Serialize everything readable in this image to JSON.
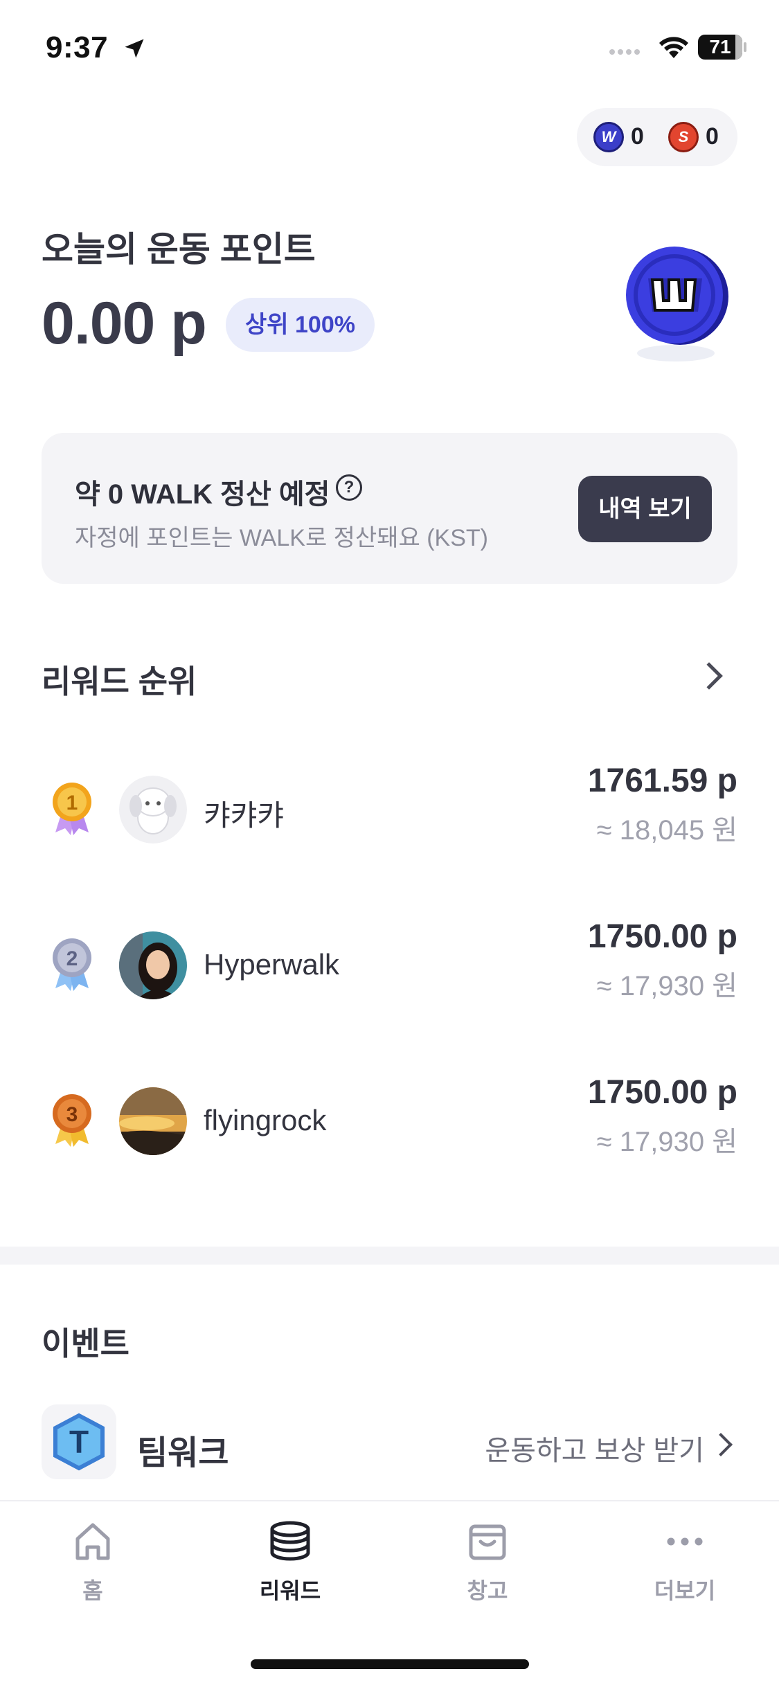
{
  "status_bar": {
    "time": "9:37",
    "battery": "71",
    "icons": [
      "location-arrow-icon",
      "signal-icon",
      "wifi-icon",
      "battery-icon"
    ]
  },
  "coins": {
    "walk_count": "0",
    "s_count": "0",
    "walk_coin_color": "#3b3ec9",
    "s_coin_color": "#e2452f"
  },
  "points": {
    "title": "오늘의 운동 포인트",
    "value": "0.00 p",
    "rank_badge": "상위 100%"
  },
  "settlement": {
    "title": "약 0 WALK 정산 예정",
    "subtitle": "자정에 포인트는 WALK로 정산돼요 (KST)",
    "button": "내역 보기"
  },
  "ranking": {
    "title": "리워드 순위",
    "rows": [
      {
        "rank": "1",
        "name": "캬캬캬",
        "points": "1761.59 p",
        "won": "≈ 18,045 원",
        "medal_color": "#f2a41c"
      },
      {
        "rank": "2",
        "name": "Hyperwalk",
        "points": "1750.00 p",
        "won": "≈ 17,930 원",
        "medal_color": "#9ea4c2"
      },
      {
        "rank": "3",
        "name": "flyingrock",
        "points": "1750.00 p",
        "won": "≈ 17,930 원",
        "medal_color": "#d66a1f"
      }
    ]
  },
  "events": {
    "title": "이벤트",
    "items": [
      {
        "name": "팀워크",
        "cta": "운동하고 보상 받기"
      }
    ]
  },
  "tab_bar": {
    "tabs": [
      {
        "label": "홈",
        "icon": "home-icon"
      },
      {
        "label": "리워드",
        "icon": "coins-icon",
        "active": true
      },
      {
        "label": "창고",
        "icon": "bag-icon"
      },
      {
        "label": "더보기",
        "icon": "more-icon"
      }
    ]
  },
  "accent_color": "#3e44c7"
}
